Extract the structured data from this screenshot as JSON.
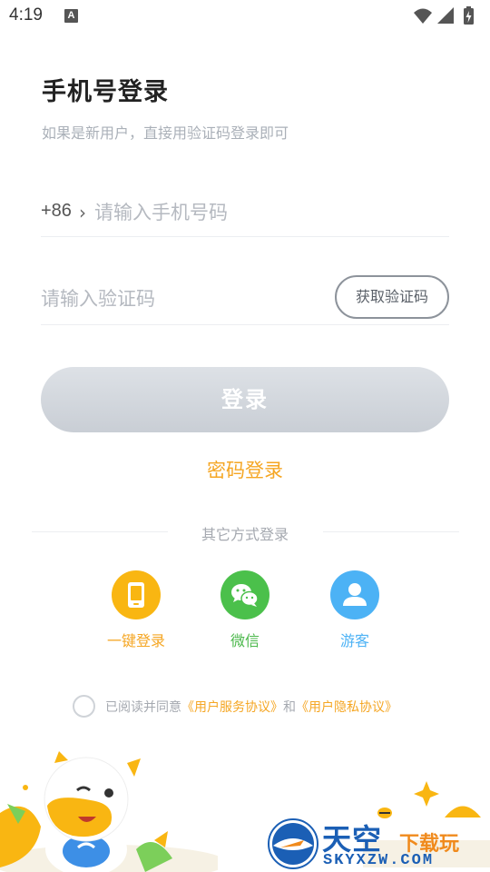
{
  "status_bar": {
    "time": "4:19",
    "notification_letter": "A",
    "icons": [
      "wifi-icon",
      "signal-icon",
      "battery-charging-icon"
    ]
  },
  "header": {
    "title": "手机号登录",
    "subtitle": "如果是新用户，直接用验证码登录即可"
  },
  "phone": {
    "country_code": "+86",
    "chevron": "›",
    "placeholder": "请输入手机号码",
    "value": ""
  },
  "code": {
    "placeholder": "请输入验证码",
    "value": "",
    "get_code_label": "获取验证码"
  },
  "login_button_label": "登录",
  "password_login_label": "密码登录",
  "other_methods": {
    "label": "其它方式登录",
    "items": [
      {
        "label": "一键登录",
        "icon": "phone-icon",
        "color": "#f9b612"
      },
      {
        "label": "微信",
        "icon": "wechat-icon",
        "color": "#4bc04b"
      },
      {
        "label": "游客",
        "icon": "user-icon",
        "color": "#4cb2f5"
      }
    ]
  },
  "agreement": {
    "prefix": "已阅读并同意",
    "link1": "《用户服务协议》",
    "middle": "和",
    "link2": "《用户隐私协议》"
  },
  "watermark": {
    "title": "天空",
    "tag": "下载玩",
    "url": "SKYXZW.COM"
  },
  "colors": {
    "accent": "#f5a623",
    "button_disabled": "#cfd4da",
    "wechat": "#4bc04b",
    "guest": "#4cb2f5"
  }
}
